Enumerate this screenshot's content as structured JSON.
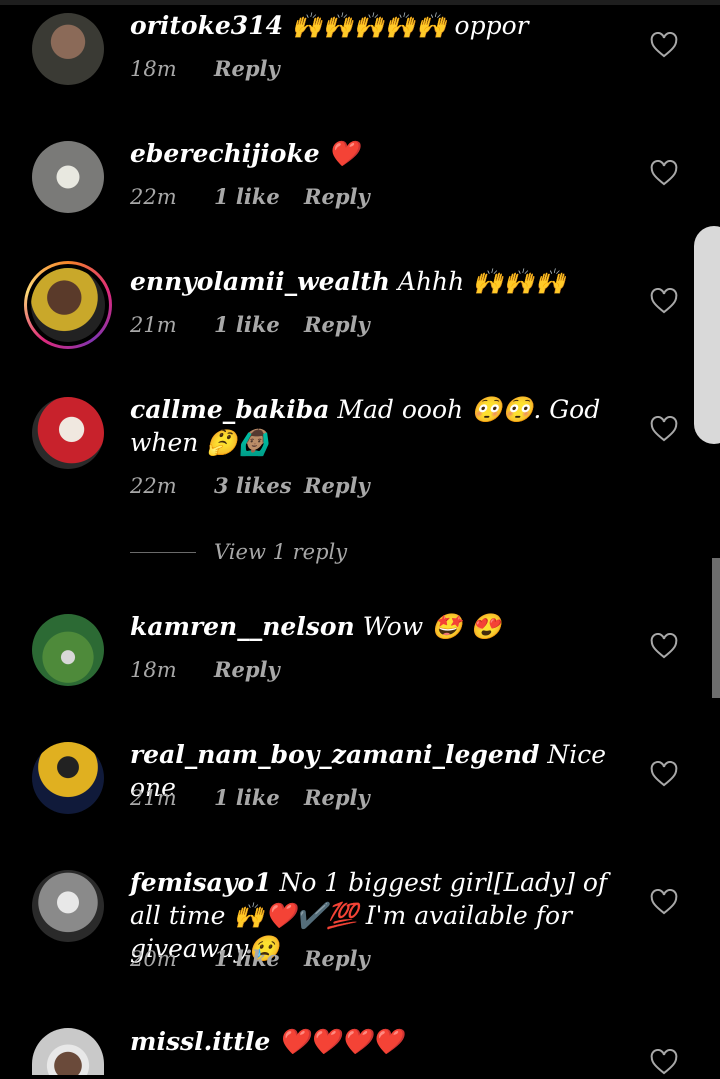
{
  "comments": [
    {
      "username": "oritoke314",
      "text": "🙌🙌🙌🙌🙌 oppor",
      "time": "18m",
      "likes": "",
      "reply": "Reply",
      "avatar_color": "#3a3a34"
    },
    {
      "username": "eberechijioke",
      "text": "❤️",
      "time": "22m",
      "likes": "1 like",
      "reply": "Reply",
      "avatar_color": "#7a7a78"
    },
    {
      "username": "ennyolamii_wealth",
      "text": "Ahhh 🙌🙌🙌",
      "time": "21m",
      "likes": "1 like",
      "reply": "Reply",
      "avatar_color": "#c9a82a"
    },
    {
      "username": "callme_bakiba",
      "text": "Mad oooh 😳😳. God when 🤔🙆🏽‍♂️",
      "time": "22m",
      "likes": "3 likes",
      "reply": "Reply",
      "avatar_color": "#c8222c"
    },
    {
      "username": "kamren__nelson",
      "text": "Wow 🤩 😍",
      "time": "18m",
      "likes": "",
      "reply": "Reply",
      "avatar_color": "#2c6a34"
    },
    {
      "username": "real_nam_boy_zamani_legend",
      "text": "Nice one",
      "time": "21m",
      "likes": "1 like",
      "reply": "Reply",
      "avatar_color": "#101a3a"
    },
    {
      "username": "femisayo1",
      "text": "No 1 biggest girl[Lady] of all time 🙌❤️✔️💯 I'm available for giveaway😢",
      "time": "20m",
      "likes": "1 like",
      "reply": "Reply",
      "avatar_color": "#8a8a8a"
    },
    {
      "username": "missl.ittle",
      "text": "❤️❤️❤️❤️",
      "time": "",
      "likes": "",
      "reply": "",
      "avatar_color": "#c9c9c9"
    }
  ],
  "view_replies": "View 1 reply",
  "icons": {
    "like": "heart-outline-icon"
  },
  "colors": {
    "background": "#000000",
    "meta": "#a8a8a8",
    "story_ring": "#dd2a7b"
  }
}
